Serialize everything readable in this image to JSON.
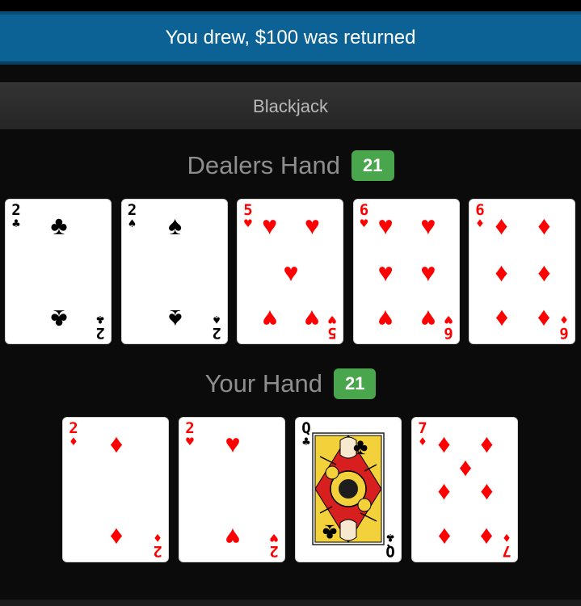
{
  "status_message": "You drew, $100 was returned",
  "title": "Blackjack",
  "dealer": {
    "label": "Dealers Hand",
    "score": "21",
    "cards": [
      {
        "rank": "2",
        "suit": "♣",
        "color": "black",
        "name": "two-of-clubs"
      },
      {
        "rank": "2",
        "suit": "♠",
        "color": "black",
        "name": "two-of-spades"
      },
      {
        "rank": "5",
        "suit": "♥",
        "color": "red",
        "name": "five-of-hearts"
      },
      {
        "rank": "6",
        "suit": "♥",
        "color": "red",
        "name": "six-of-hearts"
      },
      {
        "rank": "6",
        "suit": "♦",
        "color": "red",
        "name": "six-of-diamonds"
      }
    ]
  },
  "player": {
    "label": "Your Hand",
    "score": "21",
    "cards": [
      {
        "rank": "2",
        "suit": "♦",
        "color": "red",
        "name": "two-of-diamonds"
      },
      {
        "rank": "2",
        "suit": "♥",
        "color": "red",
        "name": "two-of-hearts"
      },
      {
        "rank": "Q",
        "suit": "♣",
        "color": "black",
        "name": "queen-of-clubs"
      },
      {
        "rank": "7",
        "suit": "♦",
        "color": "red",
        "name": "seven-of-diamonds"
      }
    ]
  },
  "colors": {
    "status_bar": "#0d6295",
    "badge": "#4aa64d",
    "red_suit": "#ff0000"
  }
}
